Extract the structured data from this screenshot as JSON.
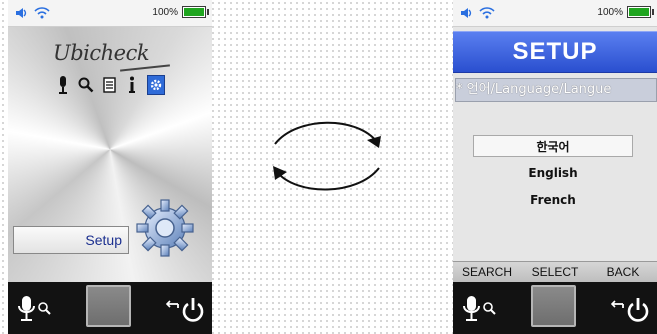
{
  "status": {
    "battery_text": "100%"
  },
  "home": {
    "logo_text": "Ubicheck",
    "icons": [
      "microphone-icon",
      "search-icon",
      "notes-icon",
      "info-icon",
      "settings-icon"
    ],
    "setup_label": "Setup"
  },
  "setup": {
    "title": "SETUP",
    "language_item": "* 언어/Language/Langue",
    "options": [
      "한국어",
      "English",
      "French"
    ],
    "softkeys": [
      "SEARCH",
      "SELECT",
      "BACK"
    ]
  },
  "colors": {
    "title_bar": "#3a5fe0",
    "battery": "#1fa51f"
  }
}
